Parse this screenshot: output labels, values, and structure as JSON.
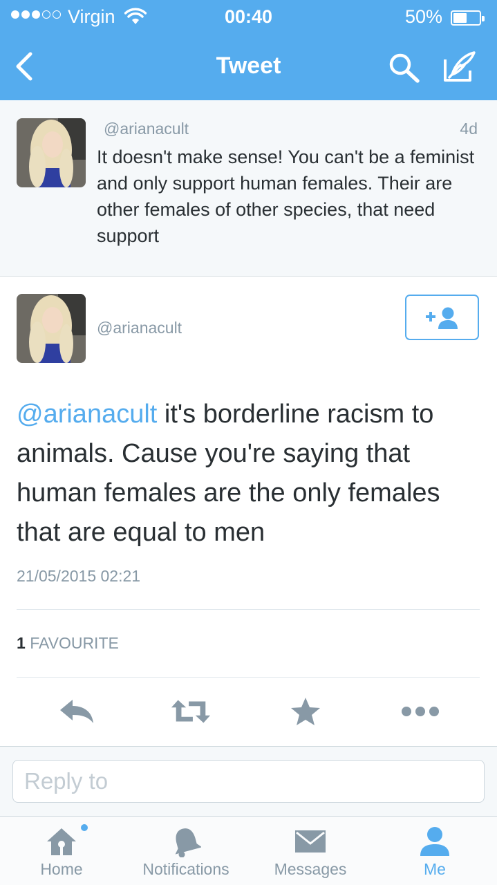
{
  "status_bar": {
    "carrier": "Virgin",
    "time": "00:40",
    "battery": "50%",
    "battery_level": 0.5,
    "signal_bars": 3
  },
  "nav": {
    "title": "Tweet",
    "back_icon": "chevron-left-icon",
    "search_icon": "search-icon",
    "compose_icon": "compose-icon"
  },
  "parent_tweet": {
    "handle": "@arianacult",
    "time": "4d",
    "text": "It doesn't make sense! You can't be a feminist and only support human females. Their are other females of other species, that need support"
  },
  "main_tweet": {
    "handle": "@arianacult",
    "mention": "@arianacult",
    "text": " it's borderline racism to animals. Cause you're saying that human females are the only females that are equal to men",
    "date": "21/05/2015 02:21",
    "favourite_count": "1",
    "favourite_label": "FAVOURITE",
    "follow_icon": "follow-user-icon",
    "actions": [
      "reply-icon",
      "retweet-icon",
      "favorite-star-icon",
      "more-dots-icon"
    ]
  },
  "reply": {
    "placeholder": "Reply to"
  },
  "tabbar": {
    "home": "Home",
    "notifications": "Notifications",
    "messages": "Messages",
    "me": "Me",
    "active": "Me"
  },
  "colors": {
    "brand": "#55acee",
    "text": "#292f33",
    "muted": "#8899a6",
    "icon_gray": "#8899a6"
  }
}
